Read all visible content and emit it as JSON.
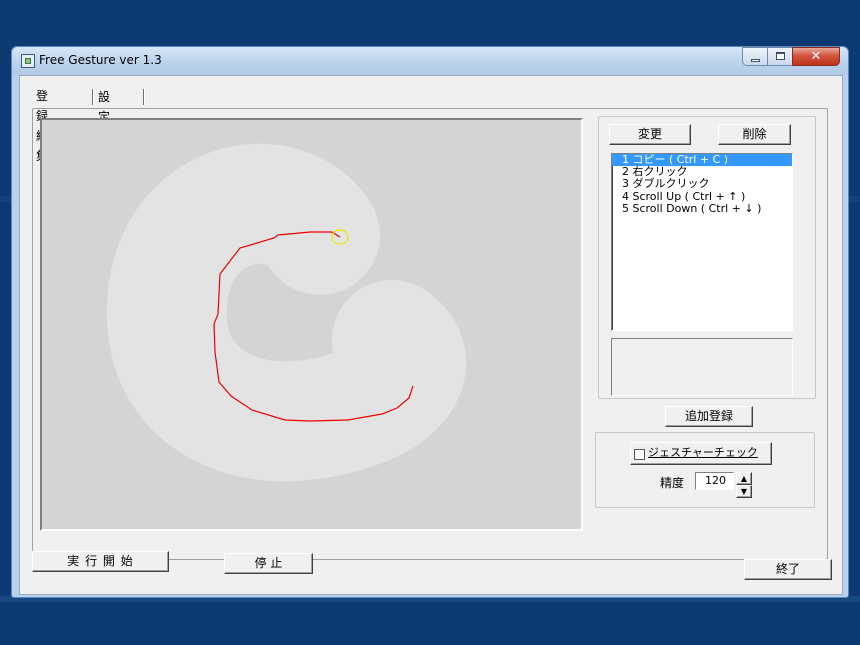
{
  "window": {
    "title": "Free Gesture  ver 1.3",
    "close_glyph": "✕"
  },
  "tabs": [
    {
      "label": "登録編集",
      "active": true
    },
    {
      "label": "設 定",
      "active": false
    }
  ],
  "buttons": {
    "change": "変更",
    "delete": "削除",
    "add": "追加登録",
    "start": "実 行 開 始",
    "stop": "停 止",
    "exit": "終了",
    "gesture_check": "ジェスチャーチェック"
  },
  "gesture_list": [
    {
      "label": "1 コピー ( Ctrl + C )",
      "selected": true
    },
    {
      "label": "2 右クリック",
      "selected": false
    },
    {
      "label": "3 ダブルクリック",
      "selected": false
    },
    {
      "label": "4 Scroll Up ( Ctrl + ↑ )",
      "selected": false
    },
    {
      "label": "5 Scroll Down ( Ctrl + ↓ )",
      "selected": false
    }
  ],
  "precision": {
    "label": "精度",
    "value": "120",
    "up_glyph": "▲",
    "down_glyph": "▼"
  },
  "gesture_check_enabled": false,
  "colors": {
    "gesture_stroke": "#ee0000",
    "guide_shape": "#e3e3e3",
    "start_marker": "#e6e600",
    "selection": "#3399ff"
  },
  "icons": {
    "app": "app-icon",
    "minimize": "minimize-icon",
    "maximize": "maximize-icon",
    "close": "close-icon"
  }
}
